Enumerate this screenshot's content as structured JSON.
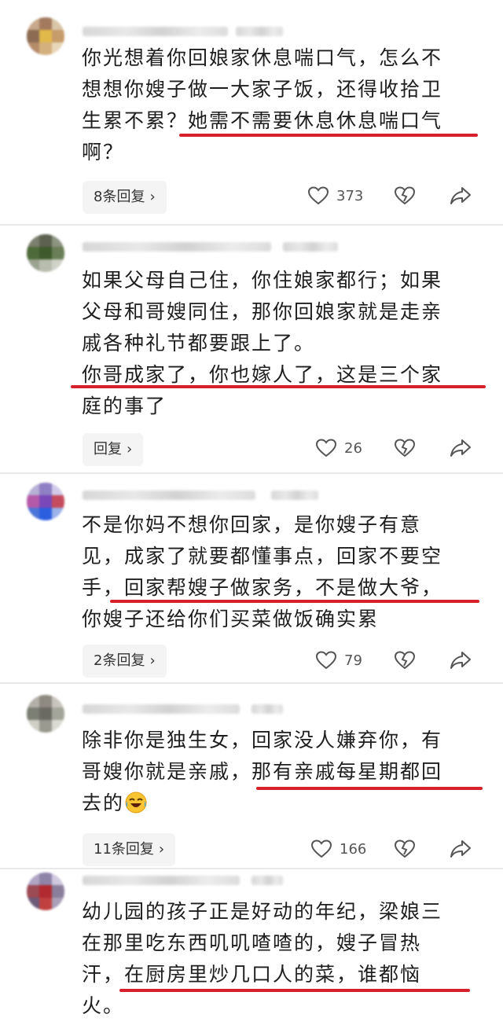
{
  "comments": [
    {
      "lines": [
        "你光想着你回娘家休息喘口气，怎么不",
        "想想你嫂子做一大家子饭，还得收拾卫",
        "生累不累？她需不需要休息休息喘口气",
        "啊？"
      ],
      "reply_label": "8条回复",
      "likes": "373"
    },
    {
      "lines": [
        "如果父母自己住，你住娘家都行；如果",
        "父母和哥嫂同住，那你回娘家就是走亲",
        "戚各种礼节都要跟上了。",
        "你哥成家了，你也嫁人了，这是三个家",
        "庭的事了"
      ],
      "reply_label": "回复",
      "likes": "26"
    },
    {
      "lines": [
        "不是你妈不想你回家，是你嫂子有意",
        "见，成家了就要都懂事点，回家不要空",
        "手，回家帮嫂子做家务，不是做大爷，",
        "你嫂子还给你们买菜做饭确实累"
      ],
      "reply_label": "2条回复",
      "likes": "79"
    },
    {
      "lines": [
        "除非你是独生女，回家没人嫌弃你，有",
        "哥嫂你就是亲戚，那有亲戚每星期都回",
        "去的"
      ],
      "reply_label": "11条回复",
      "likes": "166"
    },
    {
      "lines": [
        "幼儿园的孩子正是好动的年纪，梁娘三",
        "在那里吃东西叽叽喳喳的，嫂子冒热",
        "汗，在厨房里炒几口人的菜，谁都恼",
        "火。"
      ]
    }
  ],
  "colors": {
    "underline": "#d8202a",
    "button_bg": "#f4f4f4",
    "icon": "#555555"
  },
  "icons": {
    "like": "heart-icon",
    "dislike": "broken-heart-icon",
    "share": "share-arrow-icon",
    "reply": "chevron-right-icon",
    "emoji": "crying-laughing-emoji-icon"
  }
}
